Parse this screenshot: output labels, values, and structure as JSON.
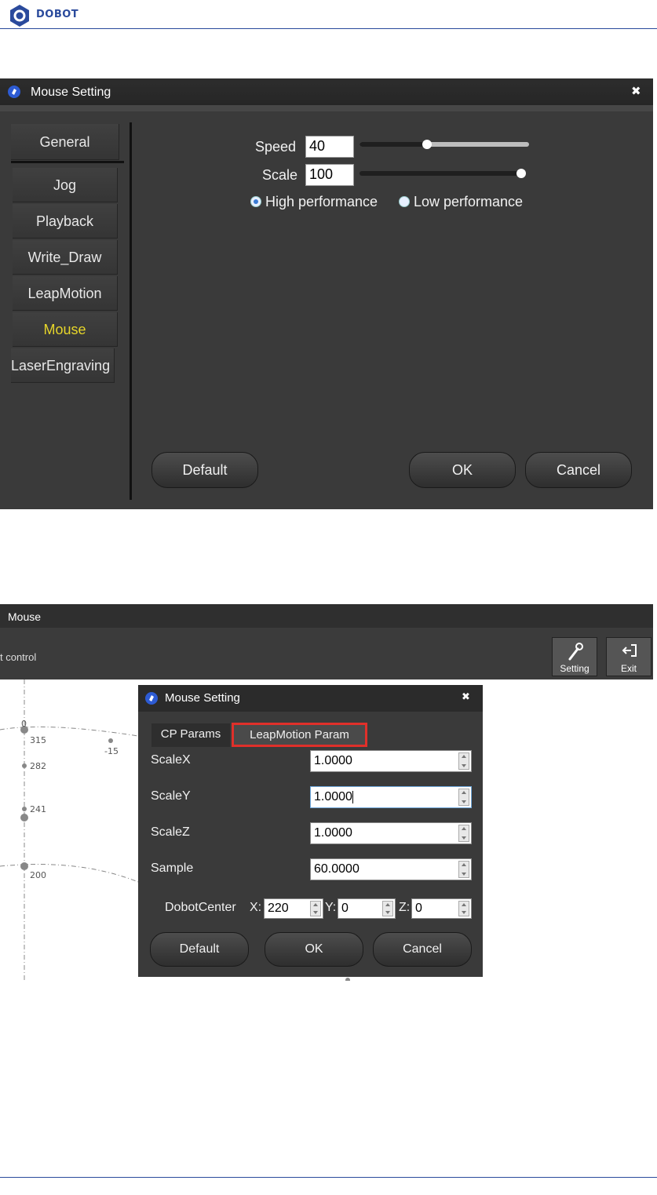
{
  "header": {
    "brand": "DOBOT",
    "brand_color": "#2a4a9c"
  },
  "dialog1": {
    "title": "Mouse Setting",
    "nav": [
      "General",
      "Jog",
      "Playback",
      "Write_Draw",
      "LeapMotion",
      "Mouse",
      "LaserEngraving"
    ],
    "active_nav": "Mouse",
    "speed": {
      "label": "Speed",
      "value": "40",
      "slider_fraction": 0.4
    },
    "scale": {
      "label": "Scale",
      "value": "100",
      "slider_fraction": 1.0
    },
    "radio": {
      "high": "High performance",
      "low": "Low performance",
      "selected": "high"
    },
    "buttons": {
      "default": "Default",
      "ok": "OK",
      "cancel": "Cancel"
    }
  },
  "window2": {
    "title": "Mouse",
    "toolbar_text": "t control",
    "toolbar_buttons": {
      "setting": "Setting",
      "exit": "Exit"
    },
    "axis_labels": [
      "0",
      "315",
      "-15",
      "282",
      "241",
      "200"
    ]
  },
  "dialog2": {
    "title": "Mouse Setting",
    "tabs": [
      "CP Params",
      "LeapMotion Param"
    ],
    "active_tab": "LeapMotion Param",
    "highlight_color": "#e0302a",
    "fields": [
      {
        "label": "ScaleX",
        "value": "1.0000"
      },
      {
        "label": "ScaleY",
        "value": "1.0000"
      },
      {
        "label": "ScaleZ",
        "value": "1.0000"
      },
      {
        "label": "Sample",
        "value": "60.0000"
      }
    ],
    "center": {
      "label": "DobotCenter",
      "x_label": "X:",
      "x": "220",
      "y_label": "Y:",
      "y": "0",
      "z_label": "Z:",
      "z": "0"
    },
    "buttons": {
      "default": "Default",
      "ok": "OK",
      "cancel": "Cancel"
    }
  }
}
